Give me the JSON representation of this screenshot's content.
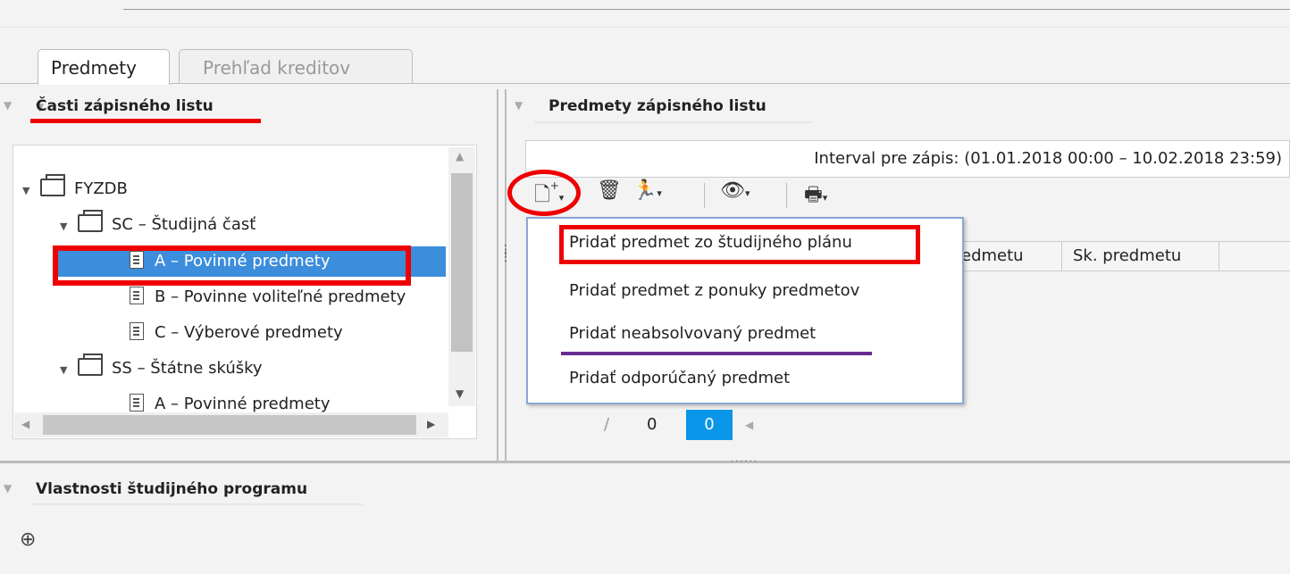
{
  "tabs": [
    "Predmety",
    "Prehľad kreditov"
  ],
  "left_panel": {
    "title": "Časti zápisného listu",
    "tree": [
      {
        "label": "FYZDB",
        "kind": "folder",
        "level": 0,
        "expanded": true
      },
      {
        "label": "SC – Študijná časť",
        "kind": "folder",
        "level": 1,
        "expanded": true
      },
      {
        "label": "A – Povinné predmety",
        "kind": "doc",
        "level": 2,
        "selected": true
      },
      {
        "label": "B – Povinne voliteľné predmety",
        "kind": "doc",
        "level": 2
      },
      {
        "label": "C – Výberové predmety",
        "kind": "doc",
        "level": 2
      },
      {
        "label": "SS – Štátne skúšky",
        "kind": "folder",
        "level": 1,
        "expanded": true
      },
      {
        "label": "A – Povinné predmety",
        "kind": "doc",
        "level": 2
      }
    ]
  },
  "right_panel": {
    "title": "Predmety zápisného listu",
    "interval": "Interval pre zápis: (01.01.2018 00:00 – 10.02.2018 23:59)",
    "columns": [
      "edmetu",
      "Sk. predmetu"
    ],
    "pager": {
      "separator": "/",
      "count": "0",
      "current": "0"
    }
  },
  "menu": {
    "items": [
      "Pridať predmet zo študijného plánu",
      "Pridať predmet z ponuky predmetov",
      "Pridať neabsolvovaný predmet",
      "Pridať odporúčaný predmet"
    ]
  },
  "bottom": {
    "title": "Vlastnosti študijného programu"
  },
  "colors": {
    "selection": "#3c8ddb",
    "highlight_red": "#e00",
    "underline_purple": "#6a2c91",
    "pager_active": "#0a96e8"
  }
}
